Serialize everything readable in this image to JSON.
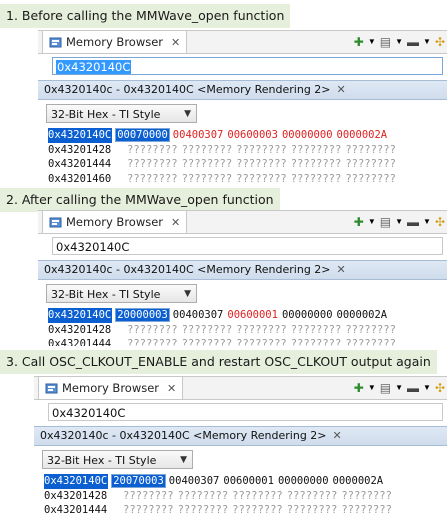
{
  "sections": [
    {
      "caption": "1. Before calling the MMWave_open function",
      "view_title": "Memory Browser",
      "address": "0x4320140C",
      "rendering_tab": "0x4320140c - 0x4320140C <Memory Rendering 2>",
      "format": "32-Bit Hex - TI Style",
      "rows": [
        {
          "addr": "0x4320140C",
          "words": [
            {
              "v": "00070000",
              "s": "box"
            },
            {
              "v": "00400307",
              "s": "red"
            },
            {
              "v": "00600003",
              "s": "red"
            },
            {
              "v": "00000000",
              "s": "red"
            },
            {
              "v": "0000002A",
              "s": "red"
            }
          ]
        },
        {
          "addr": "0x43201428",
          "words": [
            {
              "v": "????????",
              "s": "q"
            },
            {
              "v": "????????",
              "s": "q"
            },
            {
              "v": "????????",
              "s": "q"
            },
            {
              "v": "????????",
              "s": "q"
            },
            {
              "v": "????????",
              "s": "q"
            }
          ]
        },
        {
          "addr": "0x43201444",
          "words": [
            {
              "v": "????????",
              "s": "q"
            },
            {
              "v": "????????",
              "s": "q"
            },
            {
              "v": "????????",
              "s": "q"
            },
            {
              "v": "????????",
              "s": "q"
            },
            {
              "v": "????????",
              "s": "q"
            }
          ]
        },
        {
          "addr": "0x43201460",
          "words": [
            {
              "v": "????????",
              "s": "q"
            },
            {
              "v": "????????",
              "s": "q"
            },
            {
              "v": "????????",
              "s": "q"
            },
            {
              "v": "????????",
              "s": "q"
            },
            {
              "v": "????????",
              "s": "q"
            }
          ]
        }
      ]
    },
    {
      "caption": "2. After calling the MMWave_open function",
      "view_title": "Memory Browser",
      "address": "0x4320140C",
      "rendering_tab": "0x4320140c - 0x4320140C <Memory Rendering 2>",
      "format": "32-Bit Hex - TI Style",
      "rows": [
        {
          "addr": "0x4320140C",
          "words": [
            {
              "v": "20000003",
              "s": "box"
            },
            {
              "v": "00400307",
              "s": ""
            },
            {
              "v": "00600001",
              "s": "red"
            },
            {
              "v": "00000000",
              "s": ""
            },
            {
              "v": "0000002A",
              "s": ""
            }
          ]
        },
        {
          "addr": "0x43201428",
          "words": [
            {
              "v": "????????",
              "s": "q"
            },
            {
              "v": "????????",
              "s": "q"
            },
            {
              "v": "????????",
              "s": "q"
            },
            {
              "v": "????????",
              "s": "q"
            },
            {
              "v": "????????",
              "s": "q"
            }
          ]
        },
        {
          "addr": "0x43201444",
          "words": [
            {
              "v": "????????",
              "s": "q"
            },
            {
              "v": "????????",
              "s": "q"
            },
            {
              "v": "????????",
              "s": "q"
            },
            {
              "v": "????????",
              "s": "q"
            },
            {
              "v": "????????",
              "s": "q"
            }
          ]
        }
      ]
    },
    {
      "caption": "3. Call OSC_CLKOUT_ENABLE and restart OSC_CLKOUT output again",
      "view_title": "Memory Browser",
      "address": "0x4320140C",
      "rendering_tab": "0x4320140c - 0x4320140C <Memory Rendering 2>",
      "format": "32-Bit Hex - TI Style",
      "rows": [
        {
          "addr": "0x4320140C",
          "words": [
            {
              "v": "20070003",
              "s": "box"
            },
            {
              "v": "00400307",
              "s": ""
            },
            {
              "v": "00600001",
              "s": ""
            },
            {
              "v": "00000000",
              "s": ""
            },
            {
              "v": "0000002A",
              "s": ""
            }
          ]
        },
        {
          "addr": "0x43201428",
          "words": [
            {
              "v": "????????",
              "s": "q"
            },
            {
              "v": "????????",
              "s": "q"
            },
            {
              "v": "????????",
              "s": "q"
            },
            {
              "v": "????????",
              "s": "q"
            },
            {
              "v": "????????",
              "s": "q"
            }
          ]
        },
        {
          "addr": "0x43201444",
          "words": [
            {
              "v": "????????",
              "s": "q"
            },
            {
              "v": "????????",
              "s": "q"
            },
            {
              "v": "????????",
              "s": "q"
            },
            {
              "v": "????????",
              "s": "q"
            },
            {
              "v": "????????",
              "s": "q"
            }
          ]
        }
      ]
    }
  ],
  "toolbar_icons": [
    "chip-connect-icon",
    "dropdown-arrow-icon",
    "memory-map-icon",
    "dropdown-arrow-icon",
    "memory-chip-icon",
    "dropdown-arrow-icon",
    "refresh-icon"
  ],
  "colors": {
    "caption_bg": "#e6eedc",
    "selection": "#0b5fd1",
    "changed_value": "#e02020",
    "unknown_value": "#9a9a9a"
  }
}
